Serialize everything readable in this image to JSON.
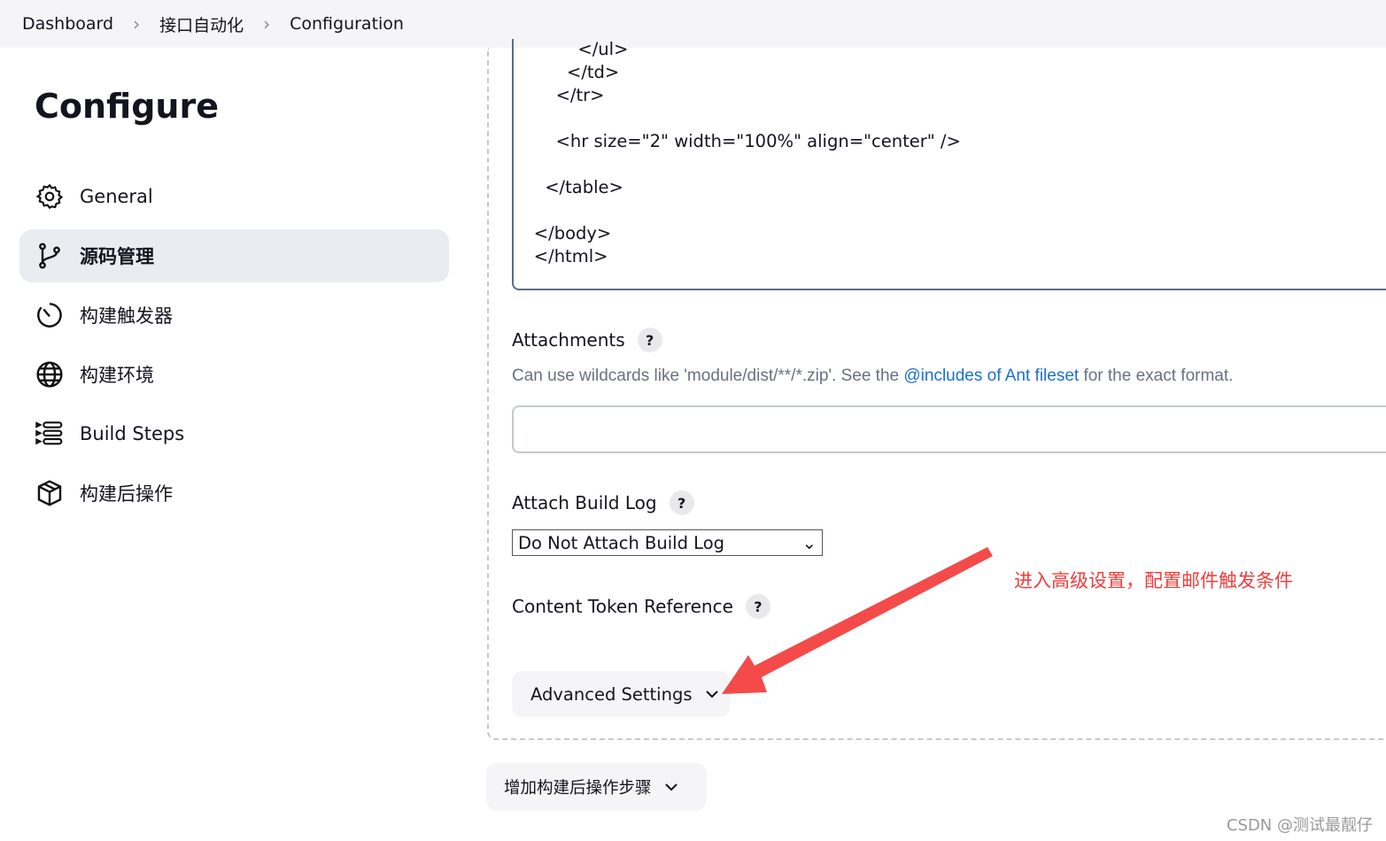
{
  "breadcrumb": [
    "Dashboard",
    "接口自动化",
    "Configuration"
  ],
  "sidebar": {
    "title": "Configure",
    "items": [
      {
        "label": "General",
        "icon": "gear-icon"
      },
      {
        "label": "源码管理",
        "icon": "branch-icon",
        "active": true
      },
      {
        "label": "构建触发器",
        "icon": "timer-icon"
      },
      {
        "label": "构建环境",
        "icon": "globe-icon"
      },
      {
        "label": "Build Steps",
        "icon": "list-steps-icon"
      },
      {
        "label": "构建后操作",
        "icon": "package-icon"
      }
    ]
  },
  "code_lines": [
    "            </ul>",
    "          </td>",
    "        </tr>",
    "",
    "        <hr size=\"2\" width=\"100%\" align=\"center\" />",
    "",
    "      </table>",
    "",
    "    </body>",
    "    </html>"
  ],
  "attachments": {
    "label": "Attachments",
    "help": "?",
    "desc_prefix": "Can use wildcards like 'module/dist/**/*.zip'. See the ",
    "desc_link": "@includes of Ant fileset",
    "desc_suffix": " for the exact format.",
    "value": ""
  },
  "build_log": {
    "label": "Attach Build Log",
    "help": "?",
    "selected": "Do Not Attach Build Log"
  },
  "token": {
    "label": "Content Token Reference",
    "help": "?"
  },
  "advanced_label": "Advanced Settings",
  "add_step_label": "增加构建后操作步骤",
  "annotation": "进入高级设置，配置邮件触发条件",
  "annotation_color": "#f44a4a",
  "watermark": "CSDN @测试最靓仔"
}
